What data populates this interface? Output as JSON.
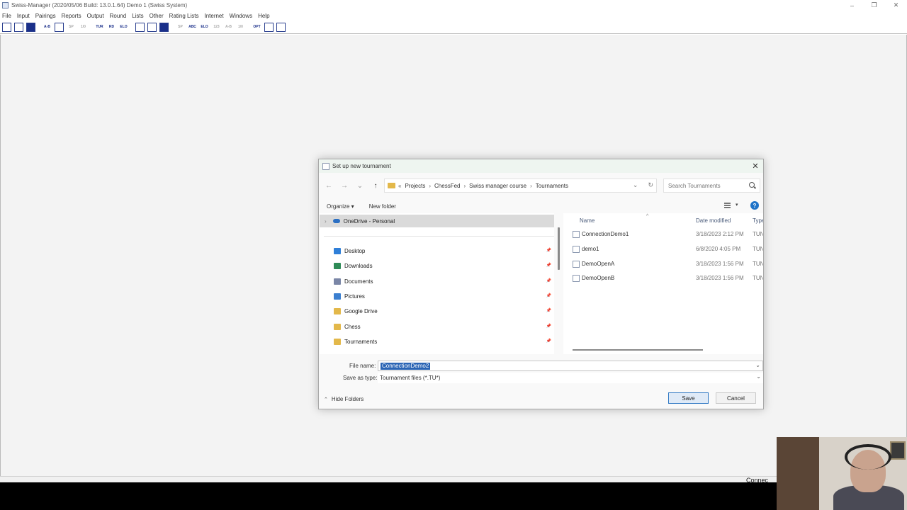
{
  "app": {
    "title": "Swiss-Manager (2020/05/06 Build: 13.0.1.64)  Demo 1   (Swiss System)",
    "window_controls": [
      "–",
      "❐",
      "✕"
    ]
  },
  "menu": [
    "File",
    "Input",
    "Pairings",
    "Reports",
    "Output",
    "Round",
    "Lists",
    "Other",
    "Rating Lists",
    "Internet",
    "Windows",
    "Help"
  ],
  "toolbar": [
    {
      "label": "",
      "icon": "new-document-icon",
      "state": "active"
    },
    {
      "label": "",
      "icon": "open-folder-icon",
      "state": "active"
    },
    {
      "label": "",
      "icon": "save-icon",
      "state": "active"
    },
    {
      "label": "A-B",
      "icon": "pairing-icon",
      "state": "active"
    },
    {
      "label": "",
      "icon": "copy-icon",
      "state": "active"
    },
    {
      "label": "SP",
      "icon": "sp-icon",
      "state": "dim"
    },
    {
      "label": "1/0",
      "icon": "results-icon",
      "state": "dim"
    },
    {
      "label": "TUR",
      "icon": "tournament-icon",
      "state": "active"
    },
    {
      "label": "RD",
      "icon": "round-icon",
      "state": "active"
    },
    {
      "label": "ELO",
      "icon": "elo-icon",
      "state": "active"
    },
    {
      "label": "",
      "icon": "export-icon",
      "state": "active"
    },
    {
      "label": "",
      "icon": "print-icon",
      "state": "active"
    },
    {
      "label": "",
      "icon": "disk-icon",
      "state": "active"
    },
    {
      "label": "SP",
      "icon": "sp2-icon",
      "state": "dim"
    },
    {
      "label": "ABC",
      "icon": "abc-icon",
      "state": "active"
    },
    {
      "label": "ELO",
      "icon": "elo2-icon",
      "state": "active"
    },
    {
      "label": "123",
      "icon": "rank-icon",
      "state": "dim"
    },
    {
      "label": "A-B",
      "icon": "pairing2-icon",
      "state": "dim"
    },
    {
      "label": "1/0",
      "icon": "results2-icon",
      "state": "dim"
    },
    {
      "label": "OPT",
      "icon": "options-icon",
      "state": "active"
    },
    {
      "label": "",
      "icon": "info-icon",
      "state": "active"
    },
    {
      "label": "",
      "icon": "link-icon",
      "state": "active"
    }
  ],
  "status": {
    "right_text": "Connec"
  },
  "dialog": {
    "title": "Set up new tournament",
    "close_glyph": "✕",
    "nav": {
      "back": "←",
      "forward": "→",
      "recent": "⌄",
      "up": "↑"
    },
    "breadcrumb": [
      "Projects",
      "ChessFed",
      "Swiss manager course",
      "Tournaments"
    ],
    "breadcrumb_prefix": "«",
    "search_placeholder": "Search Tournaments",
    "commands": {
      "organize": "Organize ▾",
      "new_folder": "New folder",
      "help": "?"
    },
    "nav_pane": {
      "onedrive": "OneDrive - Personal",
      "items": [
        {
          "label": "Desktop",
          "icon": "desktop-icon",
          "color": "#2f7fd8"
        },
        {
          "label": "Downloads",
          "icon": "download-icon",
          "color": "#2e8b57"
        },
        {
          "label": "Documents",
          "icon": "documents-icon",
          "color": "#7a86a6"
        },
        {
          "label": "Pictures",
          "icon": "pictures-icon",
          "color": "#3b7fd0"
        },
        {
          "label": "Google Drive",
          "icon": "folder-icon",
          "color": "#e3b84a"
        },
        {
          "label": "Chess",
          "icon": "folder-icon",
          "color": "#e3b84a"
        },
        {
          "label": "Tournaments",
          "icon": "folder-icon",
          "color": "#e3b84a"
        }
      ]
    },
    "file_list": {
      "columns": {
        "name": "Name",
        "date": "Date modified",
        "type": "Type"
      },
      "files": [
        {
          "name": "ConnectionDemo1",
          "date": "3/18/2023 2:12 PM",
          "type": "TUN"
        },
        {
          "name": "demo1",
          "date": "6/8/2020 4:05 PM",
          "type": "TUN"
        },
        {
          "name": "DemoOpenA",
          "date": "3/18/2023 1:56 PM",
          "type": "TUN"
        },
        {
          "name": "DemoOpenB",
          "date": "3/18/2023 1:56 PM",
          "type": "TUN"
        }
      ]
    },
    "file_name_label": "File name:",
    "file_name_value": "ConnectionDemo2",
    "save_type_label": "Save as type:",
    "save_type_value": "Tournament files (*.TU*)",
    "hide_folders": "Hide Folders",
    "save_button": "Save",
    "cancel_button": "Cancel"
  }
}
